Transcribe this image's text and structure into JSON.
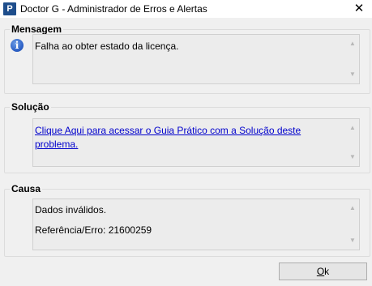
{
  "window": {
    "title": "Doctor G - Administrador de Erros e Alertas",
    "app_icon_letter": "P",
    "close_glyph": "✕"
  },
  "mensagem": {
    "label": "Mensagem",
    "icon": "info-icon",
    "text": "Falha ao obter estado da licença."
  },
  "solucao": {
    "label": "Solução",
    "link_text": "Clique Aqui para acessar o Guia Prático com a Solução deste problema."
  },
  "causa": {
    "label": "Causa",
    "line1": "Dados inválidos.",
    "line2": "Referência/Erro: 21600259"
  },
  "buttons": {
    "ok_accel": "O",
    "ok_rest": "k"
  },
  "colors": {
    "link": "#0000cc",
    "window_bg": "#f0f0f0",
    "info_icon": "#2f63c8"
  }
}
